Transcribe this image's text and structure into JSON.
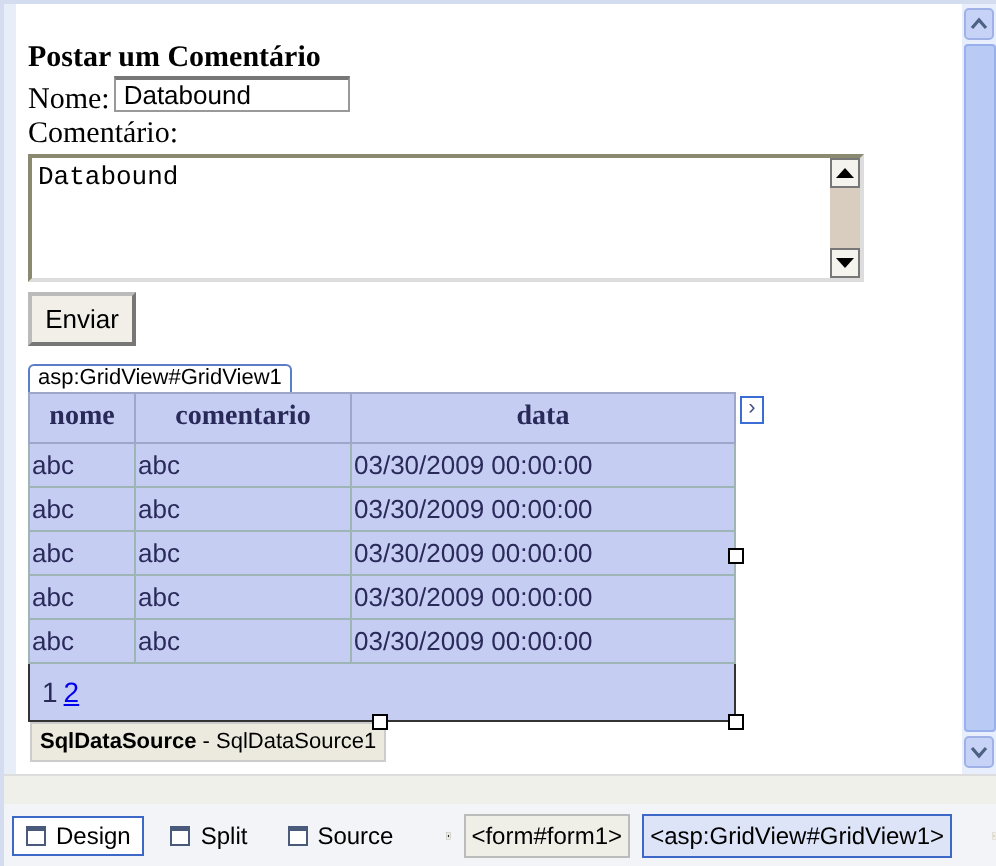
{
  "form": {
    "heading": "Postar um Comentário",
    "name_label": "Nome:",
    "name_value": "Databound",
    "comment_label": "Comentário:",
    "comment_value": "Databound",
    "submit": "Enviar"
  },
  "grid": {
    "tag": "asp:GridView#GridView1",
    "smart_tag": "›",
    "columns": [
      "nome",
      "comentario",
      "data"
    ],
    "rows": [
      [
        "abc",
        "abc",
        "03/30/2009 00:00:00"
      ],
      [
        "abc",
        "abc",
        "03/30/2009 00:00:00"
      ],
      [
        "abc",
        "abc",
        "03/30/2009 00:00:00"
      ],
      [
        "abc",
        "abc",
        "03/30/2009 00:00:00"
      ],
      [
        "abc",
        "abc",
        "03/30/2009 00:00:00"
      ]
    ],
    "pager": [
      {
        "label": "1",
        "selected": true
      },
      {
        "label": "2",
        "selected": false
      }
    ]
  },
  "datasource": {
    "type": "SqlDataSource",
    "name": " - SqlDataSource1"
  },
  "view_tabs": [
    {
      "label": "Design",
      "selected": true
    },
    {
      "label": "Split",
      "selected": false
    },
    {
      "label": "Source",
      "selected": false
    }
  ],
  "breadcrumbs": [
    {
      "label": "<form#form1>",
      "selected": false
    },
    {
      "label": "<asp:GridView#GridView1>",
      "selected": true
    }
  ]
}
